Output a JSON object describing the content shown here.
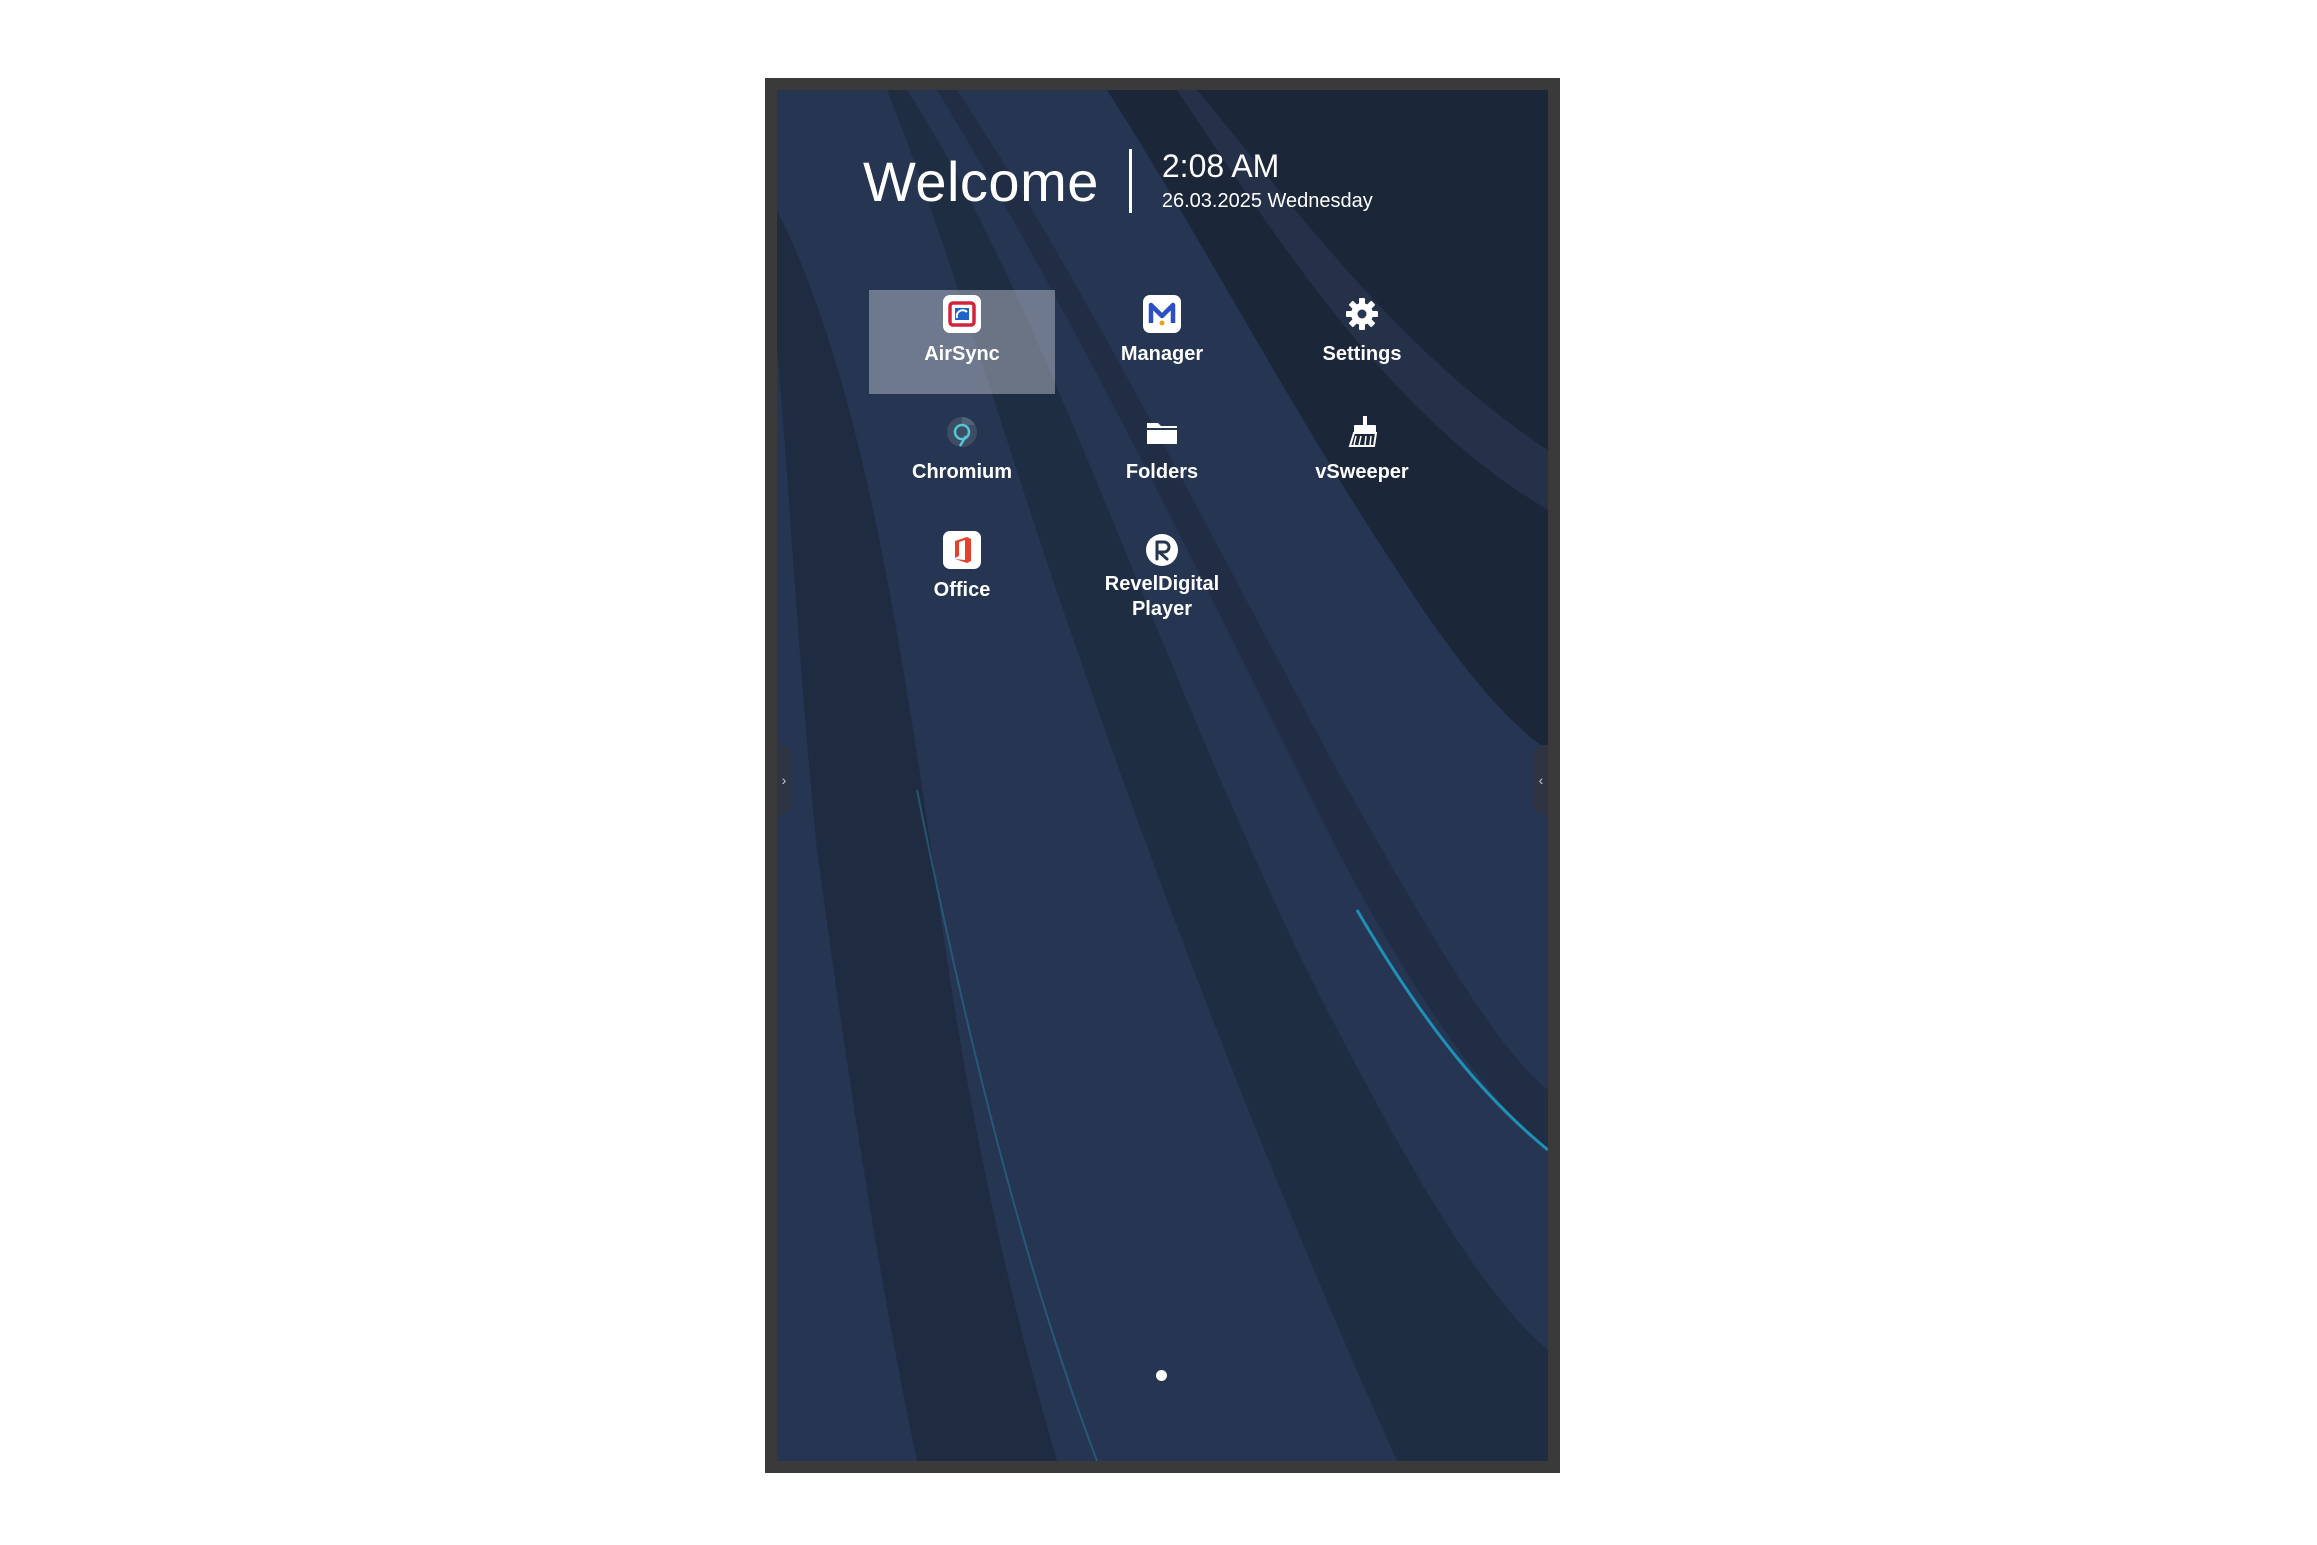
{
  "home": {
    "welcome": "Welcome",
    "time": "2:08 AM",
    "date": "26.03.2025 Wednesday"
  },
  "apps": [
    {
      "label": "AirSync",
      "icon": "airsync-icon",
      "selected": true
    },
    {
      "label": "Manager",
      "icon": "manager-icon"
    },
    {
      "label": "Settings",
      "icon": "gear-icon"
    },
    {
      "label": "Chromium",
      "icon": "chromium-icon"
    },
    {
      "label": "Folders",
      "icon": "folder-icon"
    },
    {
      "label": "vSweeper",
      "icon": "broom-icon"
    },
    {
      "label": "Office",
      "icon": "office-icon"
    },
    {
      "label": "RevelDigital\nPlayer",
      "icon": "reveldigital-icon"
    }
  ],
  "edges": {
    "left_glyph": "›",
    "right_glyph": "‹"
  },
  "colors": {
    "wallpaper_base": "#253552",
    "wallpaper_dark": "#1b2536",
    "accent_line": "#1f8fb5",
    "selection": "#c8cdd7"
  }
}
